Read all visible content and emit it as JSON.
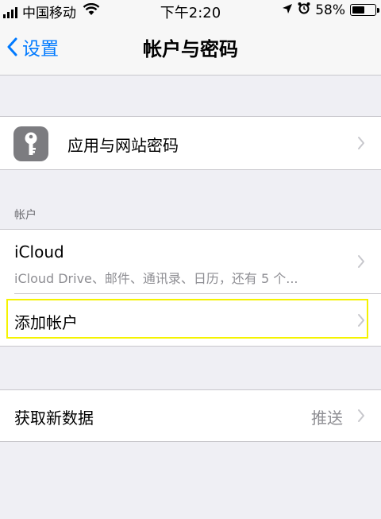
{
  "status_bar": {
    "carrier": "中国移动",
    "time": "下午2:20",
    "battery": "58%",
    "battery_level": 0.58,
    "icons": [
      "signal-icon",
      "wifi-icon",
      "location-icon",
      "alarm-icon",
      "battery-icon"
    ]
  },
  "nav": {
    "back_label": "设置",
    "title": "帐户与密码"
  },
  "passwords_row": {
    "label": "应用与网站密码",
    "icon": "key-icon"
  },
  "accounts_section": {
    "header": "帐户",
    "icloud": {
      "title": "iCloud",
      "subtitle": "iCloud Drive、邮件、通讯录、日历，还有 5 个..."
    },
    "add_account": {
      "label": "添加帐户"
    }
  },
  "fetch_row": {
    "label": "获取新数据",
    "value": "推送"
  },
  "colors": {
    "accent": "#007aff",
    "background": "#efeff4",
    "highlight": "#f5f300"
  }
}
